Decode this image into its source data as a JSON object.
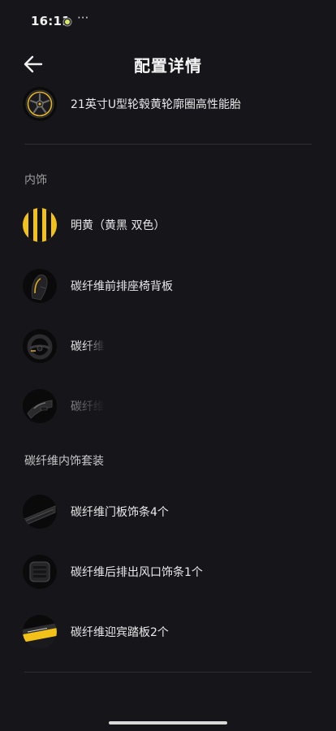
{
  "status_bar": {
    "time": "16:11",
    "more": "···"
  },
  "header": {
    "title": "配置详情",
    "back_icon": "arrow-left-icon"
  },
  "wheels": {
    "label": "21英寸U型轮毂黄轮廓圈高性能胎",
    "icon": "wheel-icon"
  },
  "interior": {
    "section_title": "内饰",
    "items": [
      {
        "label": "明黄（黄黑 双色）",
        "icon": "yellow-black-swatch-icon"
      },
      {
        "label": "碳纤维前排座椅背板",
        "icon": "seat-back-icon"
      },
      {
        "label": "碳纤维",
        "icon": "steering-wheel-icon"
      },
      {
        "label": "碳纤维",
        "icon": "gear-shifter-icon"
      }
    ]
  },
  "carbon_package": {
    "section_title": "碳纤维内饰套装",
    "items": [
      {
        "label": "碳纤维门板饰条4个",
        "icon": "door-trim-icon"
      },
      {
        "label": "碳纤维后排出风口饰条1个",
        "icon": "air-vent-icon"
      },
      {
        "label": "碳纤维迎宾踏板2个",
        "icon": "sill-plate-icon"
      }
    ]
  },
  "colors": {
    "background": "#16161a",
    "accent_yellow": "#f2c21a",
    "divider": "#2c2c31"
  }
}
